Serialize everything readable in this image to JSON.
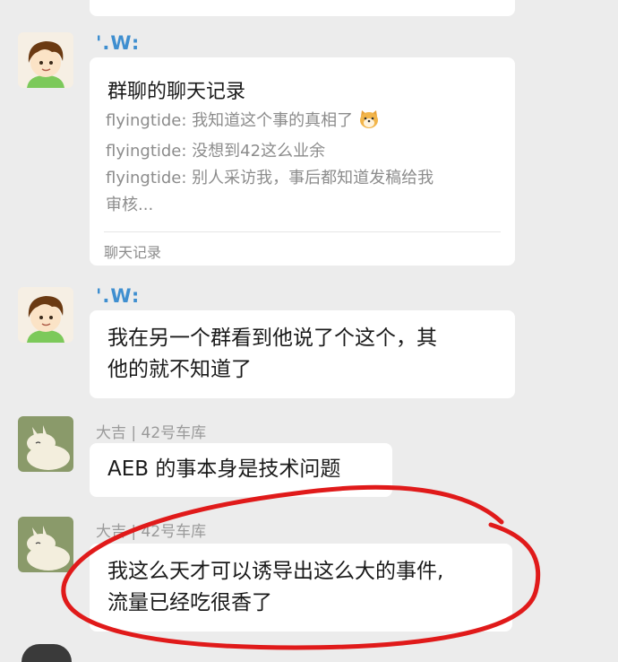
{
  "messages": [
    {
      "sender": "'.W:",
      "type": "chat_record",
      "title": "群聊的聊天记录",
      "lines": [
        "flyingtide: 我知道这个事的真相了",
        "flyingtide: 没想到42这么业余",
        "flyingtide: 别人采访我，事后都知道发稿给我",
        "审核..."
      ],
      "footer": "聊天记录"
    },
    {
      "sender": "'.W:",
      "type": "text",
      "lines": [
        "我在另一个群看到他说了个这个，其",
        "他的就不知道了"
      ]
    },
    {
      "sender": "大吉 | 42号车库",
      "type": "text",
      "lines": [
        "AEB 的事本身是技术问题"
      ]
    },
    {
      "sender": "大吉 | 42号车库",
      "type": "text",
      "lines": [
        "我这么天才可以诱导出这么大的事件,",
        "流量已经吃很香了"
      ]
    }
  ],
  "annotation_color": "#e01a1a",
  "icons": [
    "dog-emoji-icon",
    "cartoon-boy-avatar",
    "moomin-avatar"
  ]
}
